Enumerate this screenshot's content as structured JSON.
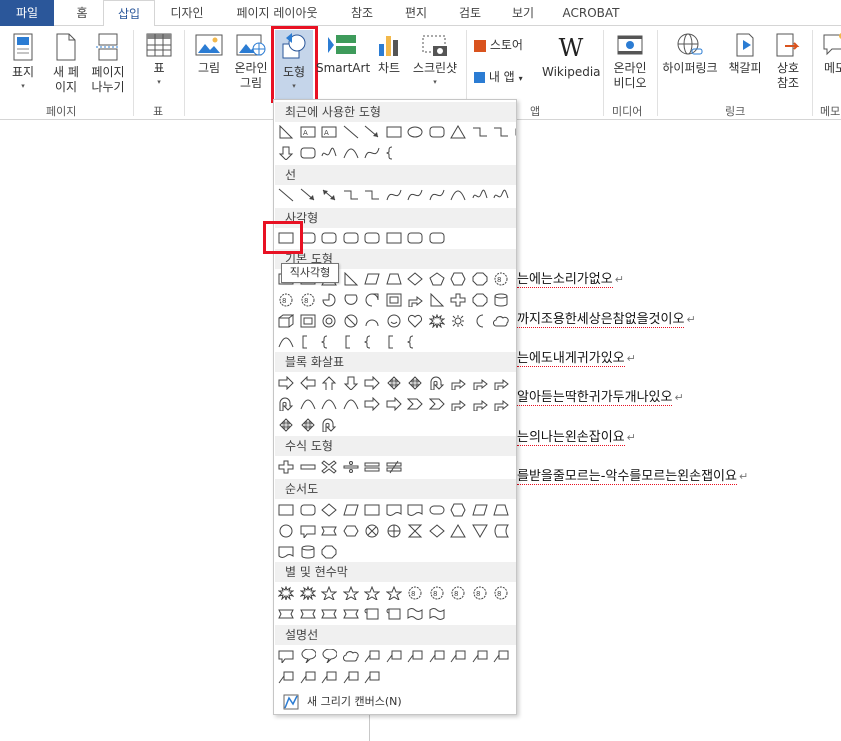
{
  "tabs": [
    "파일",
    "홈",
    "삽입",
    "디자인",
    "페이지 레이아웃",
    "참조",
    "편지",
    "검토",
    "보기",
    "ACROBAT"
  ],
  "ribbon": {
    "buttons": [
      {
        "label1": "표지",
        "label2": "",
        "caret": "▾",
        "icon": "cover-page-icon"
      },
      {
        "label1": "새 페",
        "label2": "이지",
        "caret": "",
        "icon": "blank-page-icon"
      },
      {
        "label1": "페이지",
        "label2": "나누기",
        "caret": "",
        "icon": "page-break-icon"
      },
      {
        "label1": "표",
        "label2": "",
        "caret": "▾",
        "icon": "table-icon"
      },
      {
        "label1": "그림",
        "label2": "",
        "caret": "",
        "icon": "picture-icon"
      },
      {
        "label1": "온라인",
        "label2": "그림",
        "caret": "",
        "icon": "online-picture-icon"
      },
      {
        "label1": "도형",
        "label2": "",
        "caret": "▾",
        "icon": "shapes-icon"
      },
      {
        "label1": "SmartArt",
        "label2": "",
        "caret": "",
        "icon": "smartart-icon"
      },
      {
        "label1": "차트",
        "label2": "",
        "caret": "",
        "icon": "chart-icon"
      },
      {
        "label1": "스크린샷",
        "label2": "",
        "caret": "▾",
        "icon": "screenshot-icon"
      },
      {
        "label1": "온라인",
        "label2": "비디오",
        "caret": "",
        "icon": "video-icon"
      },
      {
        "label1": "하이퍼링크",
        "label2": "",
        "caret": "",
        "icon": "hyperlink-icon"
      },
      {
        "label1": "책갈피",
        "label2": "",
        "caret": "",
        "icon": "bookmark-icon"
      },
      {
        "label1": "상호",
        "label2": "참조",
        "caret": "",
        "icon": "cross-reference-icon"
      },
      {
        "label1": "메모",
        "label2": "",
        "caret": "",
        "icon": "comment-icon"
      }
    ],
    "store": "스토어",
    "myapps": "내 앱",
    "wikipedia": "Wikipedia",
    "wiki_logo": "W",
    "groups": [
      "페이지",
      "표",
      "앱",
      "미디어",
      "링크",
      "메모"
    ]
  },
  "dropdown": {
    "sections": [
      "최근에 사용한 도형",
      "선",
      "사각형",
      "기본 도형",
      "블록 화살표",
      "수식 도형",
      "순서도",
      "별 및 현수막",
      "설명선"
    ],
    "tooltip": "직사각형",
    "new_canvas": "새 그리기 캔버스(N)",
    "new_canvas_key": "N"
  },
  "document": {
    "lines": [
      "는에는소리가없오",
      "까지조용한세상은참없을것이오",
      "는에도내게귀가있오",
      "알아듣는딱한귀가두개나있오",
      "는의나는왼손잡이요",
      "를받을줄모르는-악수를모르는왼손잽이요"
    ],
    "pilcrow": "↵"
  },
  "colors": {
    "accent": "#2b579a",
    "highlight": "#e81123"
  }
}
